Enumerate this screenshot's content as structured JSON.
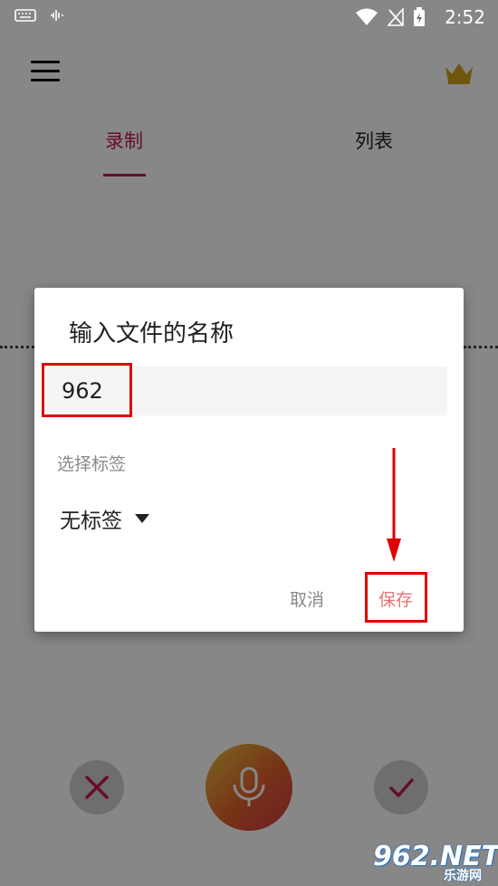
{
  "status_bar": {
    "time": "2:52"
  },
  "tabs": [
    {
      "label": "录制"
    },
    {
      "label": "列表"
    }
  ],
  "dialog": {
    "title": "输入文件的名称",
    "name_value": "962",
    "tag_label": "选择标签",
    "tag_value": "无标签",
    "cancel_label": "取消",
    "save_label": "保存"
  },
  "watermark": {
    "main": "962.NET",
    "sub": "乐游网"
  },
  "colors": {
    "accent": "#c2185b",
    "annotation": "#e00000",
    "save_text": "#e57373",
    "mic_gradient": [
      "#e8c040",
      "#e0602a",
      "#d1384a"
    ]
  },
  "icons": {
    "menu": "hamburger-menu-icon",
    "premium": "crown-icon",
    "cancel": "x-icon",
    "record": "microphone-icon",
    "confirm": "check-icon"
  }
}
